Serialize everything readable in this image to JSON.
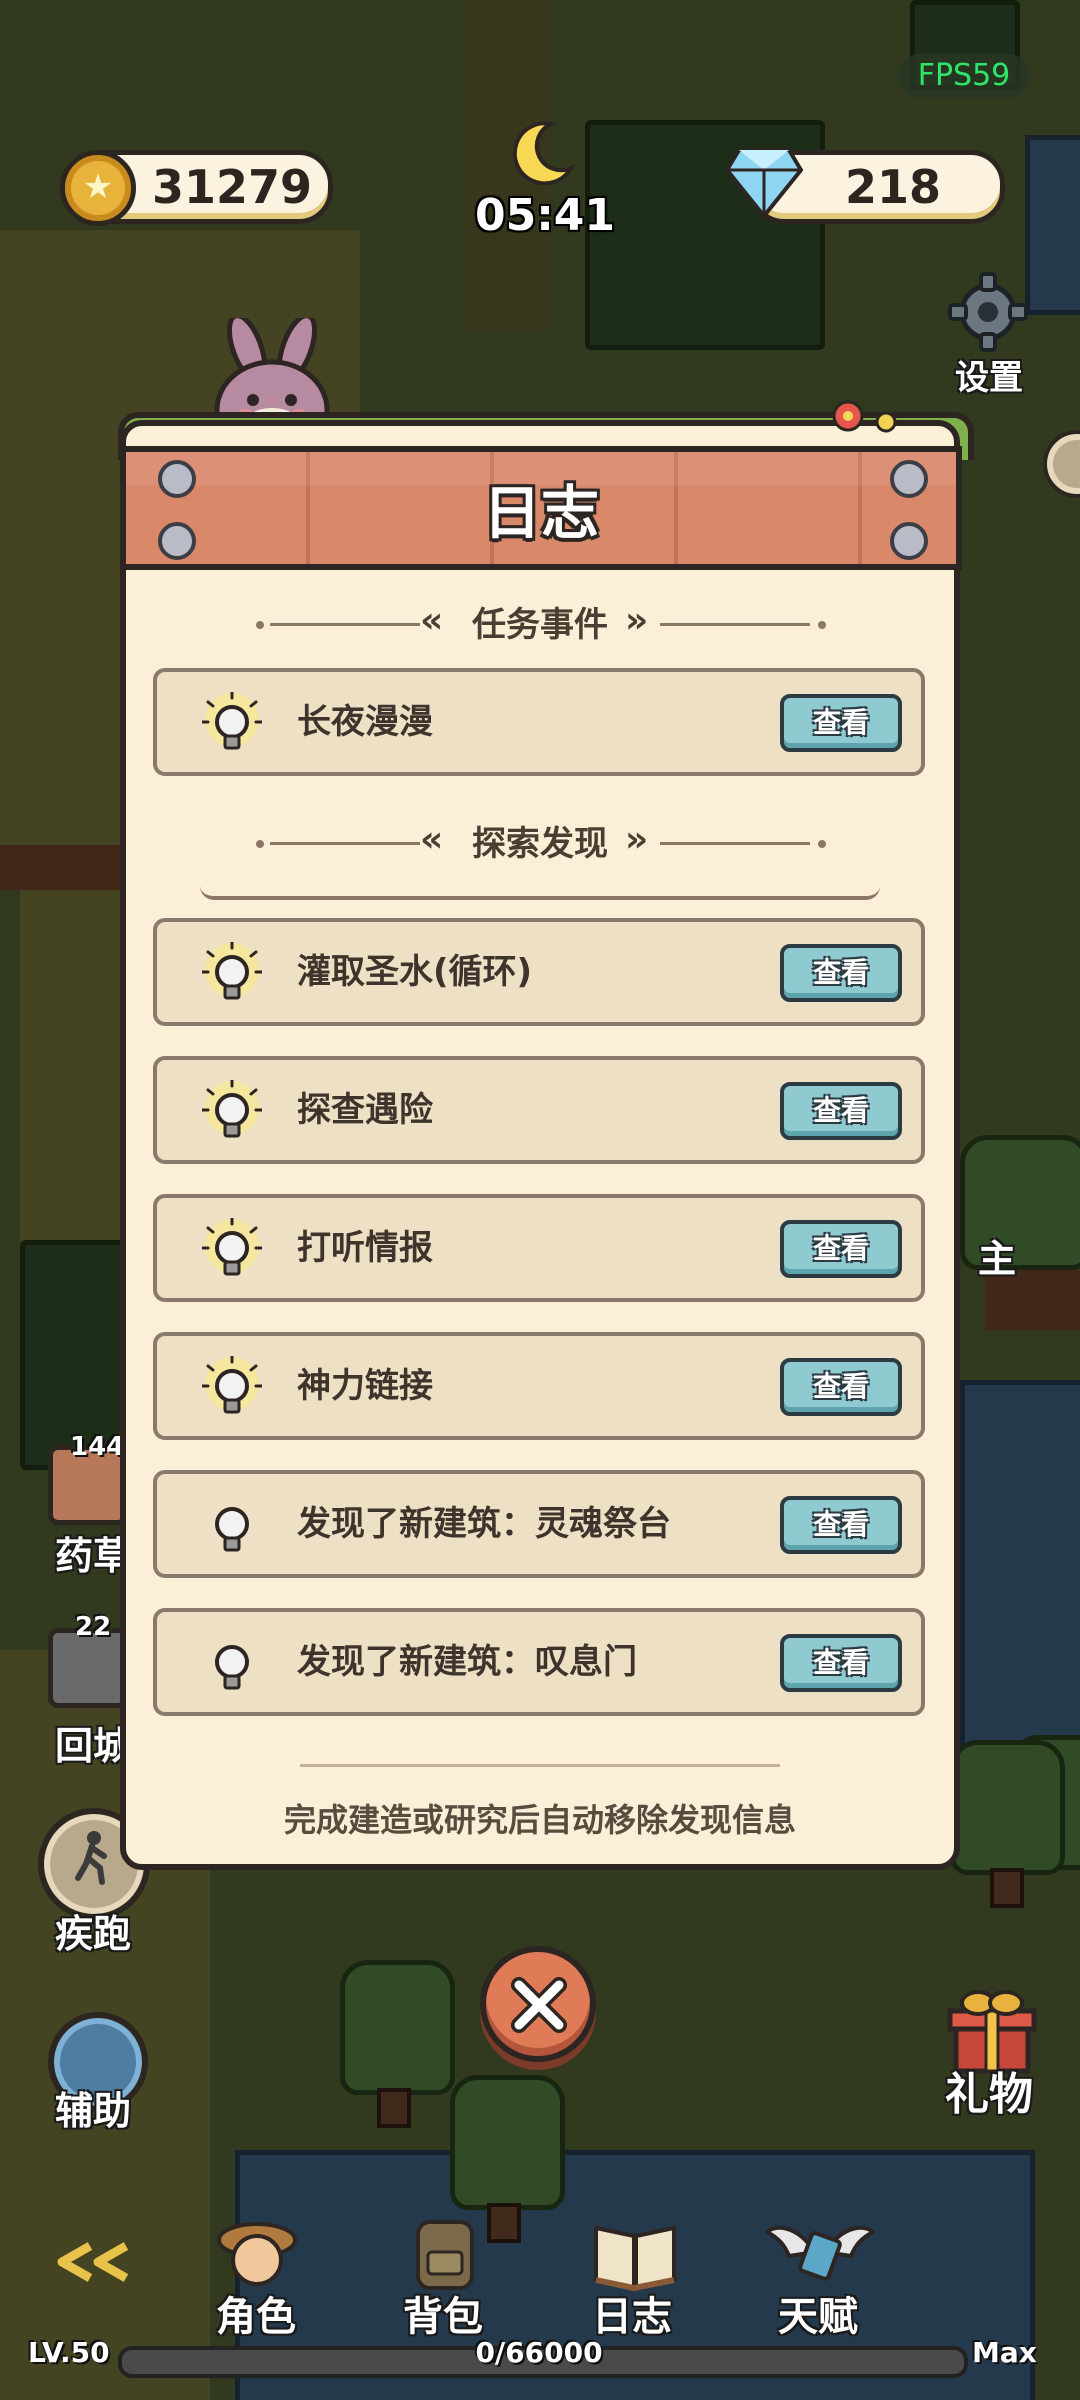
{
  "hud": {
    "fps": "FPS59",
    "coins": "31279",
    "gems": "218",
    "clock": "05:41",
    "settings_label": "设置"
  },
  "side_left": {
    "herb_count": "144",
    "herb_label": "药草",
    "return_count": "22",
    "return_label": "回城",
    "sprint_label": "疾跑",
    "assist_label": "辅助"
  },
  "side_right": {
    "partial_text": "主",
    "gift_label": "礼物"
  },
  "journal": {
    "title": "日志",
    "tasks_header": "任务事件",
    "explore_header": "探索发现",
    "view_label": "查看",
    "tasks": [
      {
        "label": "长夜漫漫",
        "highlighted": true
      }
    ],
    "discoveries": [
      {
        "label": "灌取圣水(循环)",
        "highlighted": true
      },
      {
        "label": "探查遇险",
        "highlighted": true
      },
      {
        "label": "打听情报",
        "highlighted": true
      },
      {
        "label": "神力链接",
        "highlighted": true
      },
      {
        "label": "发现了新建筑：灵魂祭台",
        "highlighted": false
      },
      {
        "label": "发现了新建筑：叹息门",
        "highlighted": false
      }
    ],
    "footer": "完成建造或研究后自动移除发现信息"
  },
  "bottom_nav": {
    "items": [
      "角色",
      "背包",
      "日志",
      "天赋"
    ]
  },
  "level": {
    "level_label": "LV.50",
    "xp_text": "0/66000",
    "xp_fraction": 0,
    "max_label": "Max"
  },
  "colors": {
    "modal_bg": "#fcefd8",
    "plank": "#d9886a",
    "view_button": "#8fcad1",
    "close_button": "#e07b58",
    "fps_text": "#2ee56b"
  }
}
